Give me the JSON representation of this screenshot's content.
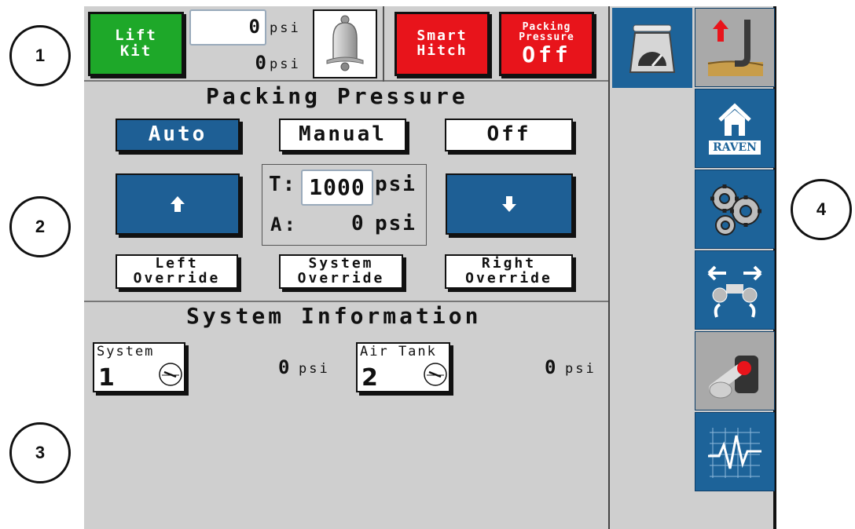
{
  "callouts": [
    "1",
    "2",
    "3",
    "4"
  ],
  "status_bar": {
    "lift_kit_label": "Lift\nKit",
    "lift_kit_color": "#1ea829",
    "pressure_input_value": "0",
    "pressure_input_unit": "psi",
    "pressure_readout_value": "0",
    "pressure_readout_unit": "psi",
    "alarm_icon": "bell-icon",
    "smart_hitch_label": "Smart\nHitch",
    "packing_pressure_title": "Packing\nPressure",
    "packing_pressure_state": "Off",
    "alert_color": "#e8141b"
  },
  "packing_pressure": {
    "title": "Packing Pressure",
    "modes": [
      "Auto",
      "Manual",
      "Off"
    ],
    "active_mode": "Auto",
    "target_label": "T:",
    "target_value": "1000",
    "target_unit": "psi",
    "actual_label": "A:",
    "actual_value": "0",
    "actual_unit": "psi",
    "increase_icon": "arrow-up-icon",
    "decrease_icon": "arrow-down-icon",
    "overrides": [
      "Left\nOverride",
      "System\nOverride",
      "Right\nOverride"
    ]
  },
  "system_information": {
    "title": "System Information",
    "sensors": [
      {
        "label": "System",
        "number": "1",
        "value": "0",
        "unit": "psi"
      },
      {
        "label": "Air Tank",
        "number": "2",
        "value": "0",
        "unit": "psi"
      }
    ]
  },
  "nav": {
    "accent_color": "#1d6399",
    "items": [
      {
        "icon": "scale-icon"
      },
      {
        "icon": "hitch-lever-icon"
      },
      {
        "icon": "raven-home-icon",
        "brand": "RAVEN"
      },
      {
        "icon": "gears-icon"
      },
      {
        "icon": "row-units-icon"
      },
      {
        "icon": "joystick-icon"
      },
      {
        "icon": "waveform-icon"
      }
    ]
  }
}
